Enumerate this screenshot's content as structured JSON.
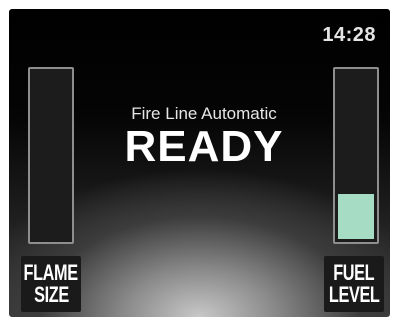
{
  "clock": {
    "time": "14:28"
  },
  "status": {
    "subtitle": "Fire Line Automatic",
    "state": "READY"
  },
  "flame_size": {
    "label_line1": "FLAME",
    "label_line2": "SIZE",
    "level": 0
  },
  "fuel_level": {
    "label_line1": "FUEL",
    "label_line2": "LEVEL",
    "level": 0.27,
    "fill_color": "#a6dcc3"
  }
}
